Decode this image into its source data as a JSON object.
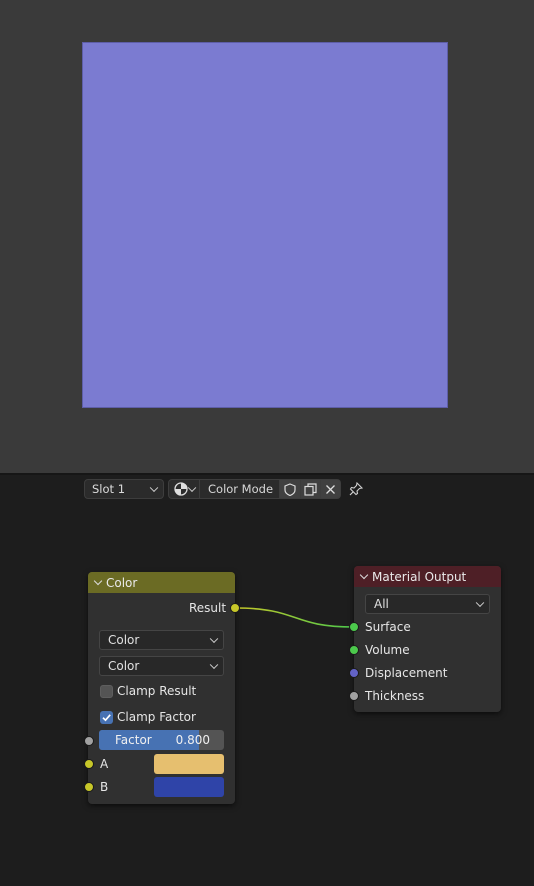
{
  "preview": {
    "color": "#7b7bd1"
  },
  "header": {
    "slot_select": "Slot 1",
    "mode_select": "Color Mode"
  },
  "color_node": {
    "title": "Color",
    "header_color": "#6b6b24",
    "output_label": "Result",
    "blend_type": "Color",
    "blend_mode": "Color",
    "clamp_result_label": "Clamp Result",
    "clamp_result_checked": false,
    "clamp_factor_label": "Clamp Factor",
    "clamp_factor_checked": true,
    "factor_label": "Factor",
    "factor_value": "0.800",
    "factor_fraction": 0.8,
    "input_a_label": "A",
    "input_a_color": "#e6bf6f",
    "input_b_label": "B",
    "input_b_color": "#2f44a8"
  },
  "output_node": {
    "title": "Material Output",
    "header_color": "#4e1f26",
    "target_select": "All",
    "inputs": [
      "Surface",
      "Volume",
      "Displacement",
      "Thickness"
    ]
  },
  "colors": {
    "socket_color": "#c7c729",
    "socket_shader": "#4cc94c",
    "socket_vector": "#6363c7",
    "socket_float": "#a1a1a1",
    "accent": "#4772b3"
  }
}
